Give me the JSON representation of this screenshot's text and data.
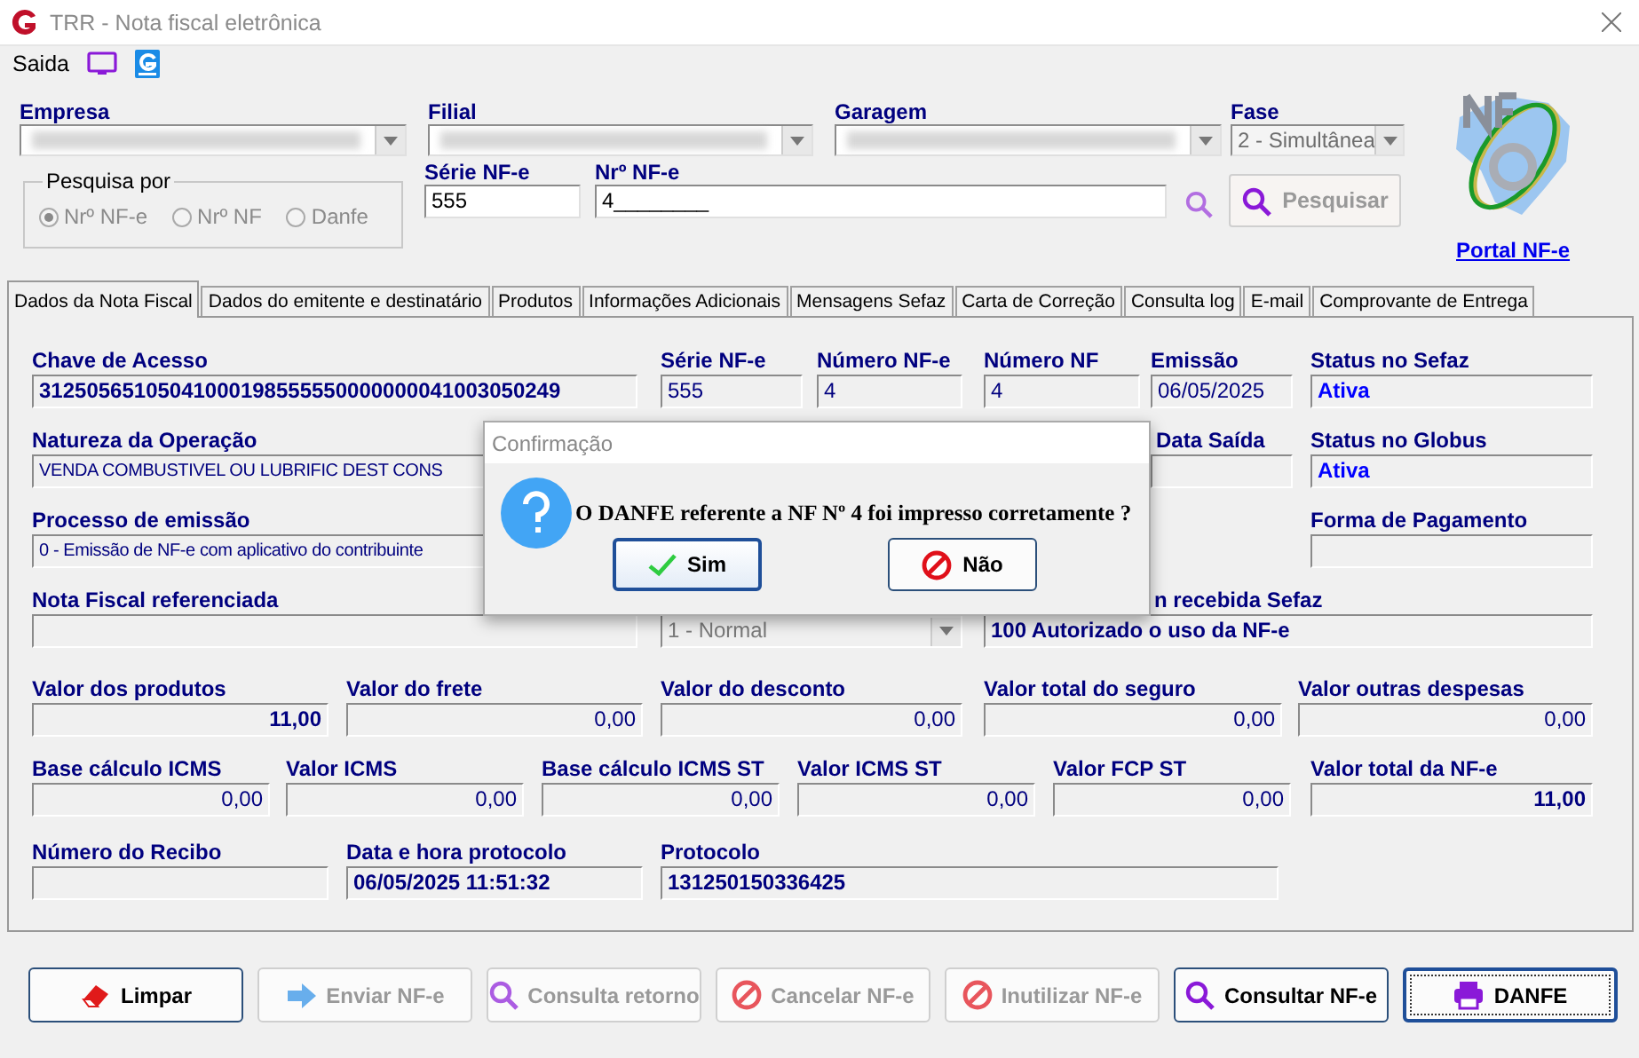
{
  "window": {
    "title": "TRR - Nota fiscal eletrônica"
  },
  "menu": {
    "label": "Saida"
  },
  "header": {
    "combos": [
      {
        "label": "Empresa",
        "blurred": true,
        "disabled": false
      },
      {
        "label": "Filial",
        "blurred": true,
        "disabled": false
      },
      {
        "label": "Garagem",
        "blurred": true,
        "disabled": false
      },
      {
        "label": "Fase",
        "value": "2 - Simultânea",
        "blurred": false,
        "disabled": true
      }
    ],
    "search_group": {
      "title": "Pesquisa por",
      "options": [
        {
          "label": "Nrº NF-e",
          "selected": true
        },
        {
          "label": "Nrº NF",
          "selected": false
        },
        {
          "label": "Danfe",
          "selected": false
        }
      ]
    },
    "serie": {
      "label": "Série NF-e",
      "value": "555"
    },
    "numero": {
      "label": "Nrº NF-e",
      "value": "4________"
    },
    "search_button": {
      "label": "Pesquisar",
      "disabled": true
    },
    "portal_link": "Portal NF-e"
  },
  "tabs": [
    {
      "label": "Dados da Nota Fiscal",
      "selected": true
    },
    {
      "label": "Dados do emitente e destinatário",
      "selected": false
    },
    {
      "label": "Produtos",
      "selected": false
    },
    {
      "label": "Informações Adicionais",
      "selected": false
    },
    {
      "label": "Mensagens Sefaz",
      "selected": false
    },
    {
      "label": "Carta de Correção",
      "selected": false
    },
    {
      "label": "Consulta log",
      "selected": false
    },
    {
      "label": "E-mail",
      "selected": false
    },
    {
      "label": "Comprovante de Entrega",
      "selected": false
    }
  ],
  "form_rows": [
    [
      {
        "label": "Chave de Acesso",
        "value": "31250565105041000198555550000000041003050249",
        "kind": "strong"
      },
      {
        "label": "Série NF-e",
        "value": "555",
        "kind": "text"
      },
      {
        "label": "Número NF-e",
        "value": "4",
        "kind": "text"
      },
      {
        "label": "Número NF",
        "value": "4",
        "kind": "text"
      },
      {
        "label": "Emissão",
        "value": "06/05/2025",
        "kind": "text"
      },
      {
        "label": "Status no Sefaz",
        "value": "Ativa",
        "kind": "status"
      }
    ],
    [
      {
        "label": "Natureza da Operação",
        "value": "VENDA COMBUSTIVEL OU LUBRIFIC DEST CONS",
        "kind": "text"
      },
      {
        "label": "Data Saída",
        "kind": "text"
      },
      {
        "label": "Status no Globus",
        "value": "Ativa",
        "kind": "status"
      }
    ],
    [
      {
        "label": "Processo de emissão",
        "value": "0 - Emissão de NF-e com aplicativo do contribuinte",
        "kind": "text"
      },
      {
        "label": "Forma de Pagamento",
        "kind": "text"
      }
    ],
    [
      {
        "label": "Nota Fiscal referenciada",
        "kind": "text"
      },
      {
        "value": "1 - Normal",
        "kind": "select"
      },
      {
        "label": "n recebida Sefaz",
        "value": "100 Autorizado o uso da NF-e",
        "kind": "strong"
      }
    ],
    [
      {
        "label": "Valor dos produtos",
        "value": "11,00",
        "kind": "total"
      },
      {
        "label": "Valor do frete",
        "value": "0,00",
        "kind": "amount"
      },
      {
        "label": "Valor do desconto",
        "value": "0,00",
        "kind": "amount"
      },
      {
        "label": "Valor total do seguro",
        "value": "0,00",
        "kind": "amount"
      },
      {
        "label": "Valor outras despesas",
        "value": "0,00",
        "kind": "amount"
      }
    ],
    [
      {
        "label": "Base cálculo ICMS",
        "value": "0,00",
        "kind": "amount"
      },
      {
        "label": "Valor ICMS",
        "value": "0,00",
        "kind": "amount"
      },
      {
        "label": "Base cálculo ICMS ST",
        "value": "0,00",
        "kind": "amount"
      },
      {
        "label": "Valor ICMS ST",
        "value": "0,00",
        "kind": "amount"
      },
      {
        "label": "Valor FCP ST",
        "value": "0,00",
        "kind": "amount"
      },
      {
        "label": "Valor total da NF-e",
        "value": "11,00",
        "kind": "total"
      }
    ],
    [
      {
        "label": "Número do Recibo",
        "kind": "text"
      },
      {
        "label": "Data e hora protocolo",
        "value": "06/05/2025 11:51:32",
        "kind": "strong"
      },
      {
        "label": "Protocolo",
        "value": "131250150336425",
        "kind": "strong"
      }
    ]
  ],
  "dialog": {
    "title": "Confirmação",
    "message": "O DANFE  referente a  NF Nº 4 foi impresso corretamente ?",
    "buttons": [
      {
        "label": "Sim",
        "focused": true
      },
      {
        "label": "Não",
        "focused": false
      }
    ]
  },
  "actions": [
    {
      "label": "Limpar",
      "disabled": false,
      "default": false
    },
    {
      "label": "Enviar NF-e",
      "disabled": true,
      "default": false
    },
    {
      "label": "Consulta retorno",
      "disabled": true,
      "default": false
    },
    {
      "label": "Cancelar NF-e",
      "disabled": true,
      "default": false
    },
    {
      "label": "Inutilizar NF-e",
      "disabled": true,
      "default": false
    },
    {
      "label": "Consultar NF-e",
      "disabled": false,
      "default": false
    },
    {
      "label": "DANFE",
      "disabled": false,
      "default": true
    }
  ]
}
